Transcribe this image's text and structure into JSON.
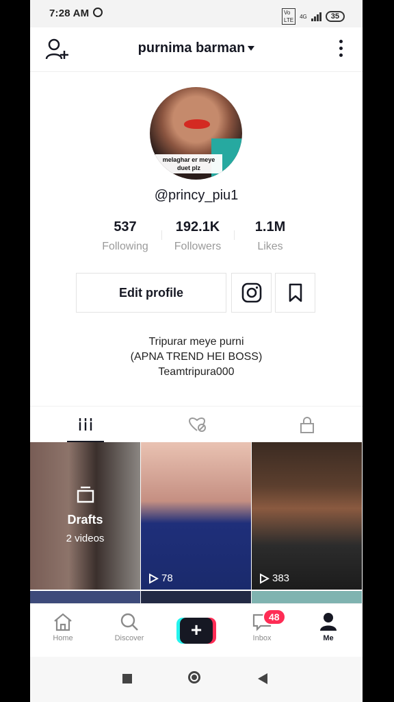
{
  "status_bar": {
    "time": "7:28 AM",
    "network": "4G",
    "battery": "35"
  },
  "header": {
    "title": "purnima barman"
  },
  "profile": {
    "avatar_caption_line1": "melaghar er meye",
    "avatar_caption_line2": "duet plz",
    "username": "@princy_piu1",
    "stats": [
      {
        "value": "537",
        "label": "Following"
      },
      {
        "value": "192.1K",
        "label": "Followers"
      },
      {
        "value": "1.1M",
        "label": "Likes"
      }
    ],
    "edit_label": "Edit profile",
    "bio": [
      "Tripurar meye purni",
      "(APNA TREND HEI BOSS)",
      "Teamtripura000"
    ]
  },
  "grid": {
    "drafts_title": "Drafts",
    "drafts_count": "2 videos",
    "videos": [
      {
        "plays": "78"
      },
      {
        "plays": "383"
      }
    ]
  },
  "bottom_nav": {
    "items": [
      "Home",
      "Discover",
      "Inbox",
      "Me"
    ],
    "create_symbol": "+",
    "inbox_badge": "48"
  }
}
